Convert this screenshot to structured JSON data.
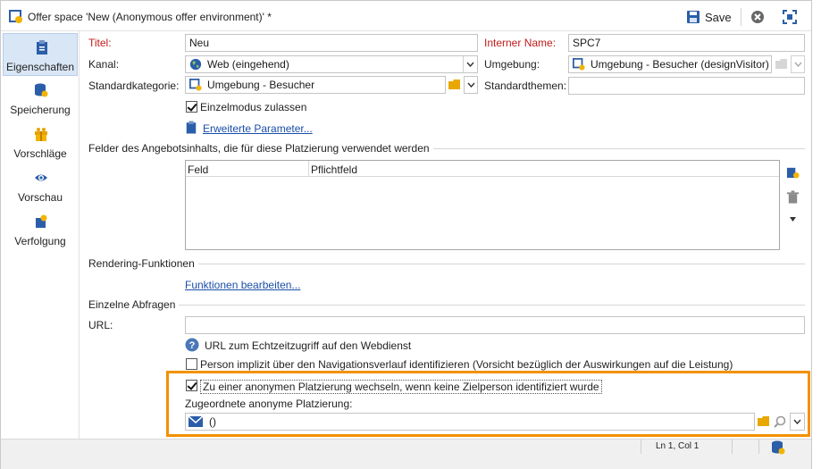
{
  "window": {
    "title": "Offer space 'New (Anonymous offer environment)' *",
    "save_label": "Save"
  },
  "nav": {
    "items": [
      {
        "label": "Eigenschaften",
        "icon": "clipboard-icon",
        "active": true
      },
      {
        "label": "Speicherung",
        "icon": "database-sync-icon"
      },
      {
        "label": "Vorschläge",
        "icon": "gift-icon"
      },
      {
        "label": "Vorschau",
        "icon": "eye-icon"
      },
      {
        "label": "Verfolgung",
        "icon": "tracking-icon"
      }
    ]
  },
  "form": {
    "titel_label": "Titel:",
    "titel_value": "Neu",
    "internal_name_label": "Interner Name:",
    "internal_name_value": "SPC7",
    "kanal_label": "Kanal:",
    "kanal_value": "Web (eingehend)",
    "umgebung_label": "Umgebung:",
    "umgebung_value": "Umgebung - Besucher (designVisitor)",
    "standardkategorie_label": "Standardkategorie:",
    "standardkategorie_value": "Umgebung - Besucher",
    "standardthemen_label": "Standardthemen:",
    "standardthemen_value": "",
    "einzelmodus_label": "Einzelmodus zulassen",
    "einzelmodus_checked": true,
    "advanced_params_link": "Erweiterte Parameter..."
  },
  "fields_section": {
    "title": "Felder des Angebotsinhalts, die für diese Platzierung verwendet werden",
    "columns": [
      "Feld",
      "Pflichtfeld"
    ],
    "rows": []
  },
  "rendering": {
    "title": "Rendering-Funktionen",
    "edit_link": "Funktionen bearbeiten..."
  },
  "single_queries": {
    "title": "Einzelne Abfragen",
    "url_label": "URL:",
    "url_value": "",
    "url_help": "URL zum Echtzeitzugriff auf den Webdienst",
    "implicit_label": "Person implizit über den Navigationsverlauf identifizieren (Vorsicht bezüglich der Auswirkungen auf die Leistung)",
    "implicit_checked": false,
    "anonymous_switch_label": "Zu einer anonymen Platzierung wechseln, wenn keine Zielperson identifiziert wurde",
    "anonymous_switch_checked": true,
    "assigned_anon_label": "Zugeordnete anonyme Platzierung:",
    "assigned_anon_value": "()"
  },
  "status": {
    "position": "Ln 1, Col 1"
  },
  "colors": {
    "highlight": "#f39100",
    "link": "#1a4ea8",
    "required_label": "#c21a1a",
    "active_nav": "#d9e6f6"
  }
}
